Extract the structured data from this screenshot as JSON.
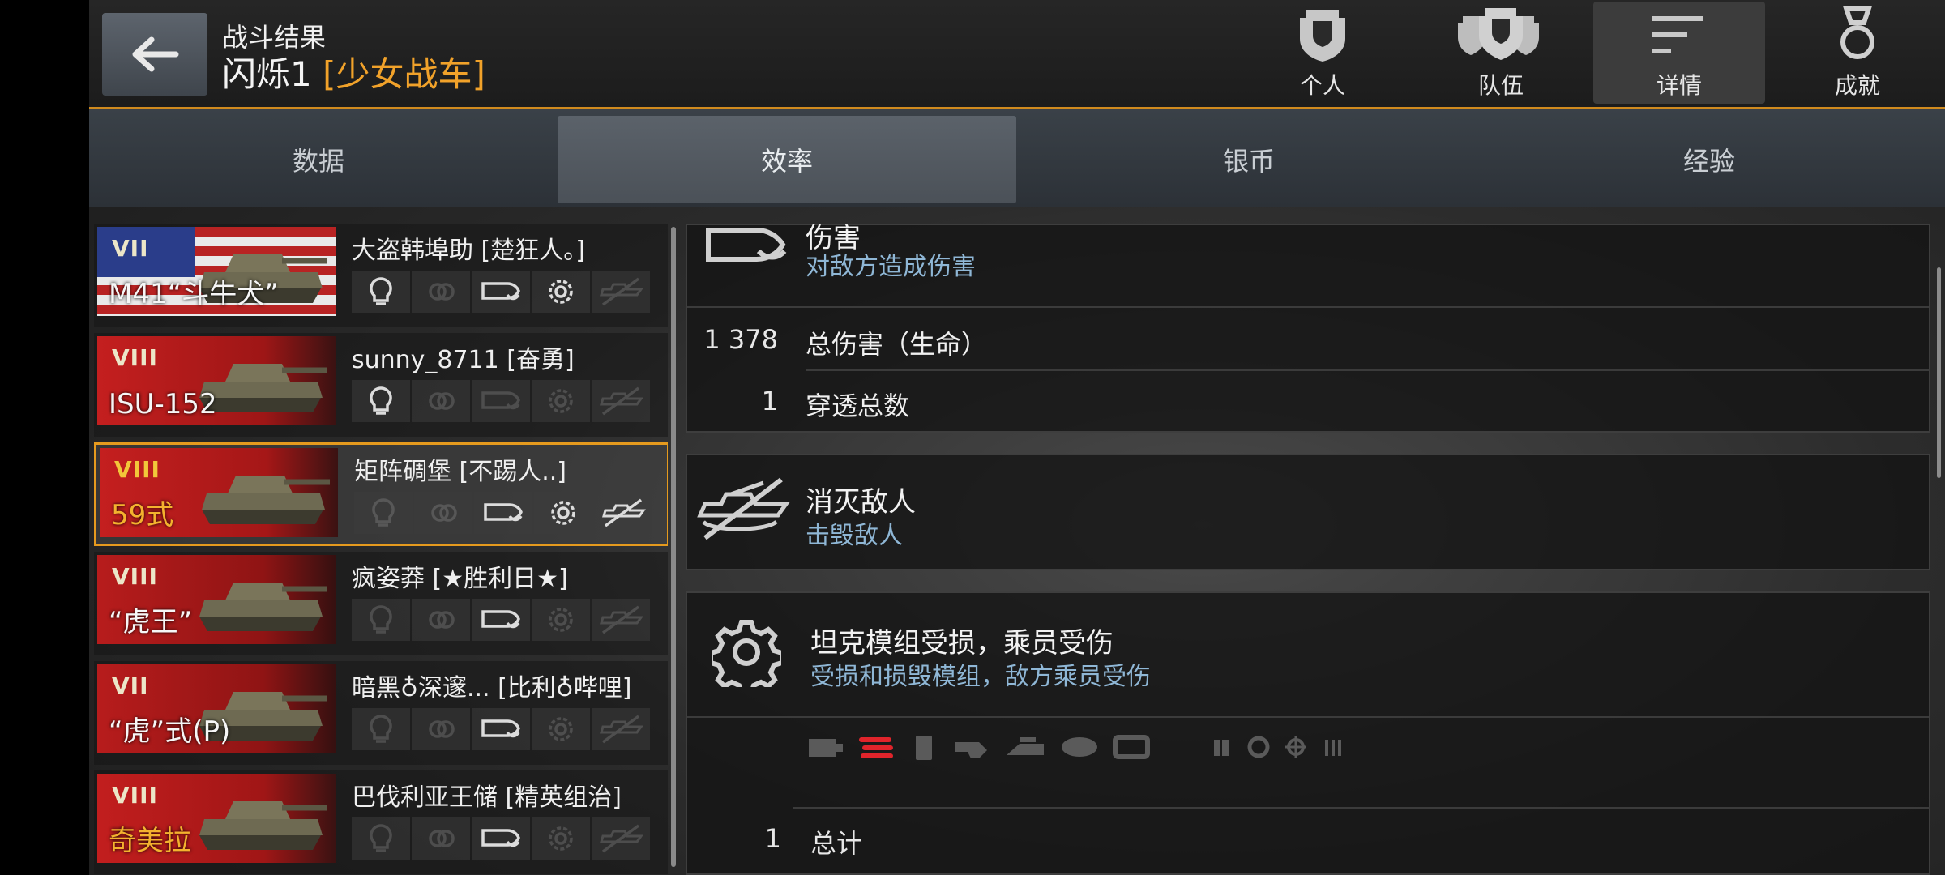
{
  "header": {
    "subtitle": "战斗结果",
    "map": "闪烁1",
    "clan": "[少女战车]",
    "tabs": [
      {
        "label": "个人",
        "icon": "helmet-icon"
      },
      {
        "label": "队伍",
        "icon": "team-icon"
      },
      {
        "label": "详情",
        "icon": "details-icon",
        "active": true
      },
      {
        "label": "成就",
        "icon": "medal-icon"
      }
    ]
  },
  "subtabs": [
    {
      "label": "数据"
    },
    {
      "label": "效率",
      "active": true
    },
    {
      "label": "银币"
    },
    {
      "label": "经验"
    }
  ],
  "players": [
    {
      "name": "大盗韩埠助 [楚狂人。]",
      "tank": "M41“斗牛犬”",
      "tier": "VII",
      "flag": "usa",
      "active_awards": [
        0,
        2,
        3
      ]
    },
    {
      "name": "sunny_8711 [奋勇]",
      "tank": "ISU-152",
      "tier": "VIII",
      "flag": "ussr",
      "active_awards": [
        0
      ]
    },
    {
      "name": "矩阵碉堡 [不踢人..]",
      "tank": "59式",
      "tier": "VIII",
      "flag": "china",
      "selected": true,
      "active_awards": [
        2,
        3,
        4
      ]
    },
    {
      "name": "疯姿莽 [★胜利日★]",
      "tank": "“虎王”",
      "tier": "VIII",
      "flag": "germany",
      "active_awards": [
        2
      ]
    },
    {
      "name": "暗黑♁深邃... [比利♁哔哩]",
      "tank": "“虎”式(P)",
      "tier": "VII",
      "flag": "germany",
      "active_awards": [
        2
      ]
    },
    {
      "name": "巴伐利亚王储 [精英组治]",
      "tank": "奇美拉",
      "tier": "VIII",
      "flag": "uk",
      "active_awards": [
        2
      ]
    }
  ],
  "damage": {
    "title": "伤害",
    "subtitle": "对敌方造成伤害",
    "rows": [
      {
        "value": "1 378",
        "label": "总伤害（生命）"
      },
      {
        "value": "1",
        "label": "穿透总数"
      }
    ]
  },
  "kills": {
    "title": "消灭敌人",
    "subtitle": "击毁敌人"
  },
  "modules": {
    "title": "坦克模组受损，乘员受伤",
    "subtitle": "受损和损毁模组，敌方乘员受伤",
    "icons": [
      "engine-icon",
      "track-icon",
      "fuel-icon",
      "gun-icon",
      "turret-icon",
      "ammo-icon",
      "radio-icon",
      "commander-icon",
      "driver-icon",
      "gunner-icon",
      "loader-icon"
    ],
    "total_value": "1",
    "total_label": "总计"
  },
  "colors": {
    "accent": "#e59a1e",
    "subtext": "#8fb7d6",
    "track_damage": "#e0242b"
  }
}
